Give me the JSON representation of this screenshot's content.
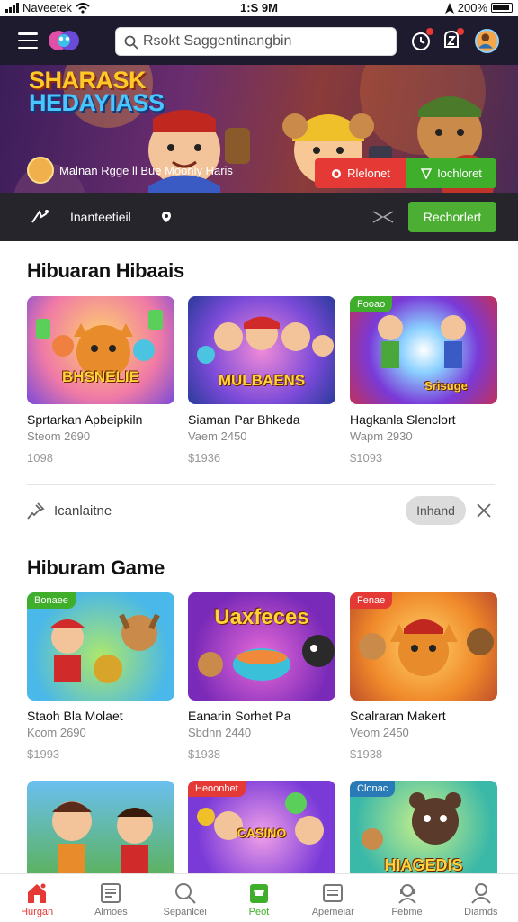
{
  "status_bar": {
    "carrier": "Naveetek",
    "time": "1:S 9M",
    "battery": "200%"
  },
  "header": {
    "search_placeholder": "Rsokt Saggentinangbin"
  },
  "banner": {
    "title_line1": "SHARASK",
    "title_line2": "HEDAYIASS",
    "user_text": "Malnan Rgge ll  Bue Moonly Haris",
    "btn_red_label": "Rlelonet",
    "btn_green_label": "Iochloret"
  },
  "strip": {
    "label": "Inanteetieil",
    "button_label": "Rechorlert"
  },
  "section1": {
    "title": "Hibuaran Hibaais",
    "cards": [
      {
        "title": "Sprtarkan Apbeipkiln",
        "sub": "Steom 2690",
        "price": "1098",
        "art": "BHSNELIE"
      },
      {
        "title": "Siaman Par Bhkeda",
        "sub": "Vaem 2450",
        "price": "$1936",
        "art": "MULBAENS"
      },
      {
        "title": "Hagkanla Slenclort",
        "sub": "Wapm 2930",
        "price": "$1093",
        "art": "Srisuge",
        "tag": "Fooao"
      }
    ]
  },
  "filter": {
    "label": "Icanlaitne",
    "pill": "Inhand"
  },
  "section2": {
    "title": "Hiburam Game",
    "cards": [
      {
        "title": "Staoh Bla Molaet",
        "sub": "Kcom 2690",
        "price": "$1993",
        "art": "",
        "tag": "Bonaee"
      },
      {
        "title": "Eanarin Sorhet Pa",
        "sub": "Sbdnn 2440",
        "price": "$1938",
        "art": "Uaxfeces"
      },
      {
        "title": "Scalraran Makert",
        "sub": "Veom 2450",
        "price": "$1938",
        "art": "",
        "tag": "Fenae"
      }
    ]
  },
  "section3": {
    "cards": [
      {
        "art": ""
      },
      {
        "art": "CASINO",
        "tag": "Heoonhet"
      },
      {
        "art": "HIAGEDIS",
        "tag": "Clonac"
      }
    ]
  },
  "bottom_nav": [
    {
      "label": "Hurgan",
      "icon": "home-icon"
    },
    {
      "label": "Almoes",
      "icon": "news-icon"
    },
    {
      "label": "Sepanlcei",
      "icon": "search-icon"
    },
    {
      "label": "Peot",
      "icon": "store-icon"
    },
    {
      "label": "Apemeiar",
      "icon": "list-icon"
    },
    {
      "label": "Febme",
      "icon": "support-icon"
    },
    {
      "label": "Diamds",
      "icon": "profile-icon"
    }
  ],
  "colors": {
    "header_bg": "#1f1b2e",
    "accent_red": "#e53935",
    "accent_green": "#3fae2a"
  }
}
